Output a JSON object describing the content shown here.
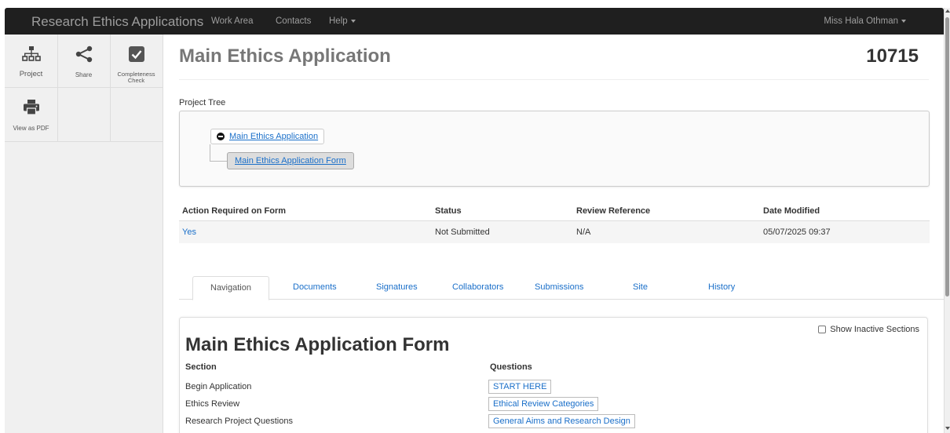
{
  "navbar": {
    "brand": "Research Ethics Applications",
    "links": [
      "Work Area",
      "Contacts",
      "Help"
    ],
    "user": "Miss Hala Othman"
  },
  "tools": [
    {
      "label": "Project",
      "icon": "sitemap-icon"
    },
    {
      "label": "Share",
      "icon": "share-icon"
    },
    {
      "label": "Completeness Check",
      "icon": "checkbox-check-icon"
    },
    {
      "label": "View as PDF",
      "icon": "printer-icon"
    }
  ],
  "page": {
    "title": "Main Ethics Application",
    "number": "10715"
  },
  "tree": {
    "label": "Project Tree",
    "root": "Main Ethics Application",
    "child": "Main Ethics Application Form"
  },
  "status_table": {
    "headers": [
      "Action Required on Form",
      "Status",
      "Review Reference",
      "Date Modified"
    ],
    "row": [
      "Yes",
      "Not Submitted",
      "N/A",
      "05/07/2025 09:37"
    ]
  },
  "tabs": [
    "Navigation",
    "Documents",
    "Signatures",
    "Collaborators",
    "Submissions",
    "Site",
    "History"
  ],
  "form": {
    "title": "Main Ethics Application Form",
    "show_inactive": "Show Inactive Sections",
    "headers": [
      "Section",
      "Questions"
    ],
    "rows": [
      {
        "section": "Begin Application",
        "question": "START HERE"
      },
      {
        "section": "Ethics Review",
        "question": "Ethical Review Categories"
      },
      {
        "section": "Research Project Questions",
        "question": "General Aims and Research Design"
      }
    ]
  },
  "colors": {
    "navbar_bg": "#1f1f1f",
    "link": "#1a6fc9",
    "panel_bg": "#f0f0f0"
  }
}
